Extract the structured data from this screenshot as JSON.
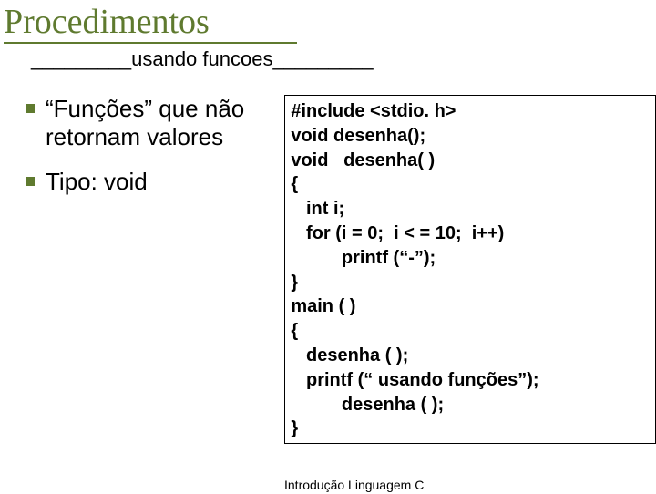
{
  "title": "Procedimentos",
  "subtitle": "_________usando  funcoes_________",
  "bullets": [
    {
      "text": "“Funções” que não retornam valores"
    },
    {
      "text": "Tipo: void"
    }
  ],
  "code": "#include <stdio. h>\nvoid desenha();\nvoid   desenha( )\n{\n   int i;\n   for (i = 0;  i < = 10;  i++)\n          printf (“-”);\n}\nmain ( )\n{\n   desenha ( );\n   printf (“ usando funções”);\n          desenha ( );\n}",
  "footer": "Introdução Linguagem C"
}
